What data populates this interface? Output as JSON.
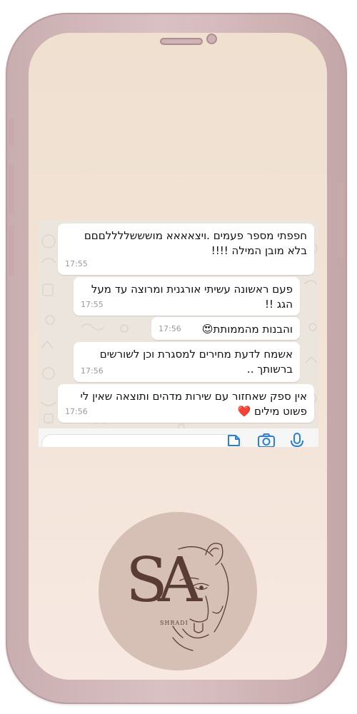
{
  "messages": [
    {
      "text": "חפפתי מספר פעמים .ויצאאאא מושששללללםםם בלא מובן המילה !!!!",
      "time": "17:55"
    },
    {
      "text": "פעם ראשונה עשיתי אורגנית ומרוצה עד מעל הגג !!",
      "time": "17:55"
    },
    {
      "text": "והבנות מהממותת😍",
      "time": "17:56"
    },
    {
      "text": "אשמח לדעת מחירים למסגרת וכן לשורשים ברשותך ..",
      "time": "17:56"
    },
    {
      "text": "אין ספק שאחזור עם שירות מדהים ותוצאה שאין לי פשוט מילים ❤️",
      "time": "17:56"
    }
  ],
  "input_icons": [
    "sticker-icon",
    "camera-icon",
    "microphone-icon"
  ],
  "logo": {
    "monogram": "SA",
    "wordmark": "SHRADI"
  },
  "colors": {
    "phone_frame": "#d2b6b8",
    "screen_background": "#f3e4d8",
    "chat_background": "#ece5dd",
    "bubble": "#ffffff",
    "accent_icon": "#2a7fd4",
    "logo_circle": "#d6c0b5",
    "logo_ink": "#5a3c36"
  }
}
